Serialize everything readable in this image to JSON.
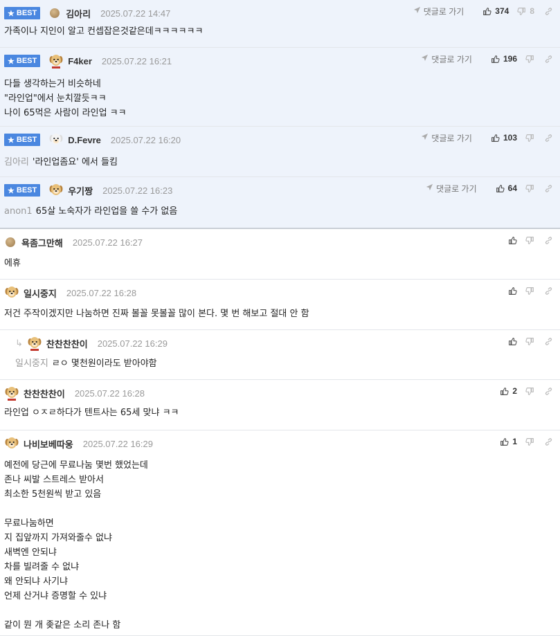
{
  "labels": {
    "best": "BEST",
    "goto": "댓글로 가기"
  },
  "comments": [
    {
      "best": true,
      "avatar": "dot",
      "nick": "김아리",
      "date": "2025.07.22 14:47",
      "up": "374",
      "down": "8",
      "goto": true,
      "ref": "",
      "lines": "가족이나 지인이 알고 컨셉잡은것같은데ㅋㅋㅋㅋㅋㅋ"
    },
    {
      "best": true,
      "avatar": "dog-red",
      "nick": "F4ker",
      "date": "2025.07.22 16:21",
      "up": "196",
      "down": "",
      "goto": true,
      "ref": "",
      "lines": "다들 생각하는거 비슷하네\n\"라인업\"에서 눈치깔듯ㅋㅋ\n나이 65먹은 사람이 라인업 ㅋㅋ"
    },
    {
      "best": true,
      "avatar": "dog-white",
      "nick": "D.Fevre",
      "date": "2025.07.22 16:20",
      "up": "103",
      "down": "",
      "goto": true,
      "ref": "김아리",
      "lines": "'라인업좀요' 에서 들킴"
    },
    {
      "best": true,
      "avatar": "dog",
      "nick": "우기짱",
      "date": "2025.07.22 16:23",
      "up": "64",
      "down": "",
      "goto": true,
      "ref": "anon1",
      "lines": "65살 노숙자가 라인업을 쓸 수가 없음"
    },
    {
      "best": false,
      "avatar": "dot",
      "nick": "욕좀그만해",
      "date": "2025.07.22 16:27",
      "up": "",
      "down": "",
      "goto": false,
      "ref": "",
      "lines": "에휴"
    },
    {
      "best": false,
      "avatar": "dog",
      "nick": "일시중지",
      "date": "2025.07.22 16:28",
      "up": "",
      "down": "",
      "goto": false,
      "ref": "",
      "lines": "저건 주작이겠지만 나눔하면 진짜 볼꼴 못볼꼴 많이 본다. 몇 번 해보고 절대 안 함"
    },
    {
      "best": false,
      "reply": true,
      "avatar": "dog-red",
      "nick": "찬찬찬찬이",
      "date": "2025.07.22 16:29",
      "up": "",
      "down": "",
      "goto": false,
      "ref": "일시중지",
      "lines": "ㄹㅇ 몇천원이라도 받아야함"
    },
    {
      "best": false,
      "avatar": "dog-red",
      "nick": "찬찬찬찬이",
      "date": "2025.07.22 16:28",
      "up": "2",
      "down": "",
      "goto": false,
      "ref": "",
      "lines": "라인업 ㅇㅈㄹ하다가 텐트사는 65세 맞냐 ㅋㅋ"
    },
    {
      "best": false,
      "avatar": "dog",
      "nick": "나비보베따웅",
      "date": "2025.07.22 16:29",
      "up": "1",
      "down": "",
      "goto": false,
      "ref": "",
      "lines": "예전에 당근에 무료나눔 몇번 했었는데\n존나 씨발 스트레스 받아서\n최소한 5천원씩 받고 있음\n\n무료나눔하면\n지 집앞까지 가져와줄수 없냐\n새벽엔 안되냐\n차를 빌려줄 수 없냐\n왜 안되냐 사기냐\n언제 산거냐 증명할 수 있냐\n\n같이 뭔 개 좆같은 소리 존나 함"
    }
  ]
}
